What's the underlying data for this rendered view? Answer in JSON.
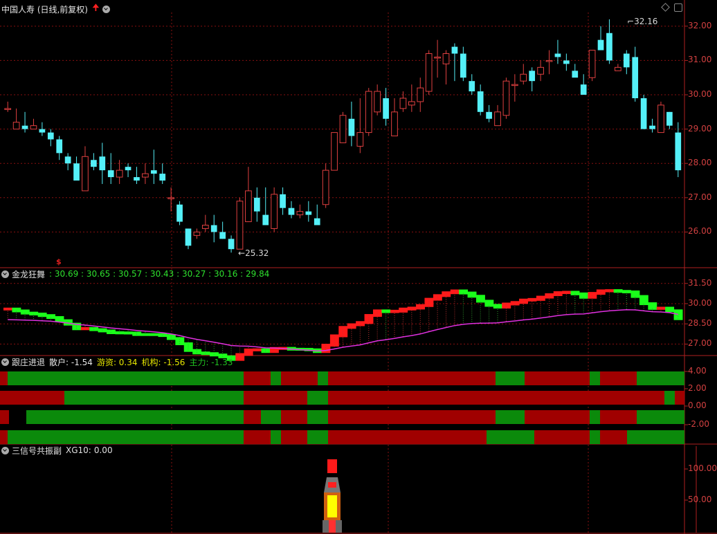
{
  "main": {
    "title": "中国人寿 (日线,前复权)",
    "y_ticks": [
      "32.00",
      "31.00",
      "30.00",
      "29.00",
      "28.00",
      "27.00",
      "26.00"
    ],
    "high_label": "32.16",
    "low_label": "25.32",
    "event_marker": "$"
  },
  "indicators": {
    "jinlong": {
      "name": "金龙狂舞",
      "values": [
        "30.69",
        "30.65",
        "30.57",
        "30.43",
        "30.27",
        "30.16",
        "29.84"
      ],
      "y_ticks": [
        "31.50",
        "30.00",
        "28.50",
        "27.00"
      ]
    },
    "genzhuang": {
      "name": "跟庄进退",
      "items": [
        {
          "label": "散户:",
          "value": "-1.54",
          "color": "#e8e8e8"
        },
        {
          "label": "游资:",
          "value": "0.34",
          "color": "#e6e600"
        },
        {
          "label": "机构:",
          "value": "-1.56",
          "color": "#e6e600"
        },
        {
          "label": "主力:",
          "value": "-1.33",
          "color": "#20c020"
        }
      ],
      "y_ticks": [
        "4.00",
        "2.00",
        "0.00",
        "-2.00"
      ]
    },
    "sanxinhao": {
      "name": "三信号共振副",
      "xg_label": "XG10:",
      "xg_value": "0.00",
      "y_ticks": [
        "100.00",
        "50.00"
      ]
    }
  },
  "colors": {
    "up": "#e04040",
    "down": "#54f0f8",
    "grid": "#8a1010",
    "axis": "#b02020",
    "ma_magenta": "#e030e0",
    "bar_red": "#a00000",
    "bar_green": "#0b8a0b",
    "step_red": "#ff1a1a",
    "step_green": "#1aff1a"
  },
  "chart_data": {
    "type": "candlestick",
    "main_y_range": [
      25.0,
      32.4
    ],
    "candles": [
      [
        29.6,
        29.6,
        29.8,
        29.5
      ],
      [
        29.0,
        29.2,
        29.6,
        29.0
      ],
      [
        29.1,
        29.0,
        29.5,
        28.9
      ],
      [
        29.0,
        29.1,
        29.3,
        29.0
      ],
      [
        29.0,
        28.9,
        29.2,
        28.8
      ],
      [
        28.9,
        28.7,
        29.0,
        28.5
      ],
      [
        28.7,
        28.3,
        28.8,
        28.1
      ],
      [
        28.2,
        28.0,
        28.3,
        27.8
      ],
      [
        28.0,
        27.5,
        28.2,
        27.5
      ],
      [
        27.2,
        28.2,
        28.5,
        27.2
      ],
      [
        28.1,
        27.9,
        28.3,
        27.8
      ],
      [
        28.2,
        27.8,
        28.6,
        27.4
      ],
      [
        27.8,
        27.6,
        28.3,
        27.4
      ],
      [
        27.6,
        27.8,
        28.1,
        27.4
      ],
      [
        27.9,
        27.8,
        28.0,
        27.6
      ],
      [
        27.6,
        27.5,
        27.9,
        27.4
      ],
      [
        27.6,
        27.7,
        28.0,
        27.4
      ],
      [
        27.8,
        27.7,
        28.4,
        27.4
      ],
      [
        27.7,
        27.5,
        28.0,
        27.4
      ],
      [
        27.0,
        27.0,
        27.3,
        26.6
      ],
      [
        26.8,
        26.3,
        26.9,
        26.2
      ],
      [
        26.1,
        25.6,
        26.1,
        25.5
      ],
      [
        25.9,
        26.0,
        26.1,
        25.8
      ],
      [
        26.1,
        26.2,
        26.5,
        26.0
      ],
      [
        26.2,
        26.0,
        26.5,
        25.7
      ],
      [
        26.0,
        25.8,
        26.3,
        25.8
      ],
      [
        25.8,
        25.5,
        25.9,
        25.4
      ],
      [
        25.5,
        26.9,
        27.0,
        25.5
      ],
      [
        26.3,
        27.2,
        27.9,
        26.3
      ],
      [
        27.0,
        26.6,
        27.3,
        26.3
      ],
      [
        26.5,
        26.2,
        27.3,
        26.2
      ],
      [
        26.1,
        27.1,
        27.3,
        26.0
      ],
      [
        27.1,
        26.7,
        27.3,
        26.5
      ],
      [
        26.7,
        26.5,
        26.9,
        26.4
      ],
      [
        26.5,
        26.6,
        26.8,
        26.4
      ],
      [
        26.6,
        26.5,
        26.9,
        26.3
      ],
      [
        26.4,
        26.2,
        26.8,
        26.3
      ],
      [
        26.8,
        27.8,
        28.0,
        26.7
      ],
      [
        27.8,
        28.9,
        28.9,
        27.8
      ],
      [
        28.6,
        29.4,
        29.5,
        28.6
      ],
      [
        29.3,
        28.8,
        29.8,
        28.5
      ],
      [
        28.5,
        28.9,
        29.9,
        28.3
      ],
      [
        28.9,
        30.1,
        30.2,
        28.8
      ],
      [
        29.5,
        30.1,
        30.3,
        29.4
      ],
      [
        29.9,
        29.3,
        30.2,
        29.1
      ],
      [
        28.8,
        29.5,
        29.9,
        28.8
      ],
      [
        29.6,
        29.9,
        30.1,
        29.5
      ],
      [
        29.7,
        29.8,
        30.3,
        29.5
      ],
      [
        29.8,
        30.2,
        30.5,
        29.5
      ],
      [
        30.1,
        31.2,
        31.3,
        30.0
      ],
      [
        31.1,
        31.1,
        31.6,
        30.5
      ],
      [
        30.9,
        31.2,
        31.3,
        30.3
      ],
      [
        31.4,
        31.2,
        31.5,
        30.4
      ],
      [
        31.2,
        30.5,
        31.4,
        30.4
      ],
      [
        30.4,
        30.1,
        30.6,
        30.0
      ],
      [
        30.1,
        29.5,
        30.3,
        29.4
      ],
      [
        29.5,
        29.3,
        29.7,
        29.2
      ],
      [
        29.1,
        29.5,
        29.7,
        29.1
      ],
      [
        29.4,
        30.4,
        30.5,
        29.3
      ],
      [
        30.3,
        30.3,
        30.6,
        29.8
      ],
      [
        30.4,
        30.6,
        30.9,
        30.3
      ],
      [
        30.7,
        30.4,
        30.8,
        30.1
      ],
      [
        30.6,
        30.8,
        31.0,
        30.4
      ],
      [
        31.0,
        31.0,
        31.3,
        30.6
      ],
      [
        31.2,
        31.1,
        31.6,
        30.9
      ],
      [
        31.0,
        30.9,
        31.2,
        30.7
      ],
      [
        30.7,
        30.5,
        30.9,
        30.6
      ],
      [
        30.3,
        30.0,
        30.6,
        30.2
      ],
      [
        30.5,
        31.3,
        31.3,
        30.4
      ],
      [
        31.6,
        31.3,
        32.0,
        31.3
      ],
      [
        31.8,
        31.0,
        32.2,
        30.9
      ],
      [
        30.7,
        30.8,
        30.9,
        30.7
      ],
      [
        31.2,
        30.8,
        31.3,
        30.6
      ],
      [
        31.1,
        29.9,
        31.4,
        29.8
      ],
      [
        29.9,
        29.0,
        30.0,
        29.0
      ],
      [
        29.1,
        29.0,
        29.3,
        28.9
      ],
      [
        28.9,
        29.7,
        29.8,
        28.9
      ],
      [
        29.5,
        29.1,
        29.5,
        29.0
      ],
      [
        28.9,
        27.8,
        29.2,
        27.6
      ]
    ],
    "main_high": 32.16,
    "main_low": 25.32
  }
}
